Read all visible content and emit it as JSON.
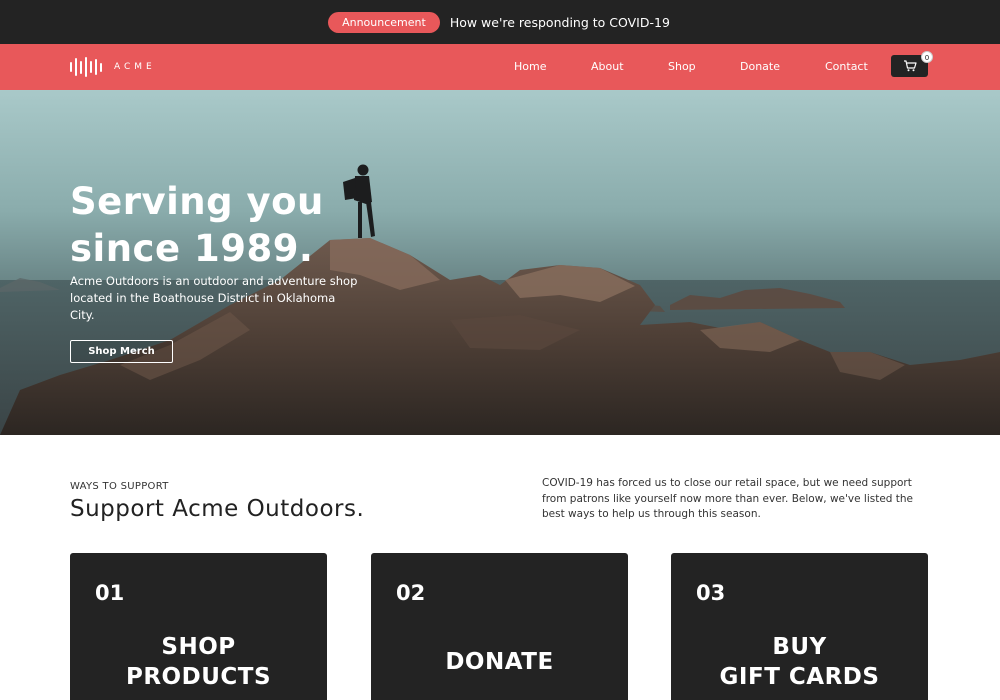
{
  "announcement": {
    "pill_label": "Announcement",
    "message": "How we're responding to COVID-19"
  },
  "header": {
    "logo_text": "ACME",
    "nav": {
      "home": "Home",
      "about": "About",
      "shop": "Shop",
      "donate": "Donate",
      "contact": "Contact"
    },
    "cart_icon": "cart-icon",
    "cart_count": "0"
  },
  "hero": {
    "title": "Serving you since 1989.",
    "description": "Acme Outdoors is an outdoor and adventure shop located in the Boathouse District in Oklahoma City.",
    "cta_label": "Shop Merch"
  },
  "support": {
    "eyebrow": "WAYS TO SUPPORT",
    "title": "Support Acme Outdoors.",
    "description": "COVID-19 has forced us to close our retail space, but we need support from patrons like yourself now more than ever. Below, we've listed the best ways to help us through this season.",
    "cards": [
      {
        "number": "01",
        "title": "SHOP\nPRODUCTS"
      },
      {
        "number": "02",
        "title": "DONATE"
      },
      {
        "number": "03",
        "title": "BUY\nGIFT CARDS"
      }
    ]
  },
  "colors": {
    "accent": "#e8585a",
    "dark": "#232323",
    "white": "#ffffff"
  }
}
